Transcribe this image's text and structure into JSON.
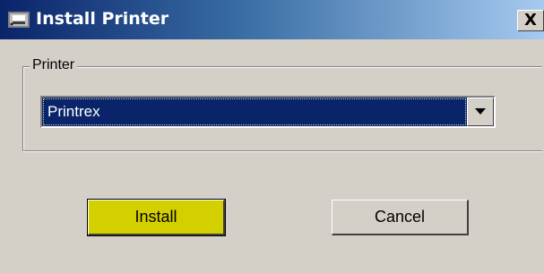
{
  "window": {
    "title": "Install Printer",
    "close_label": "X"
  },
  "printer_group": {
    "legend": "Printer",
    "selected_printer": "Printrex"
  },
  "buttons": {
    "install_label": "Install",
    "cancel_label": "Cancel"
  },
  "colors": {
    "titlebar_start": "#0a246a",
    "titlebar_end": "#a6caf0",
    "selection": "#0a246a",
    "install_button": "#d4d000",
    "face": "#d4d0c8"
  },
  "icons": {
    "app": "printer-app-icon",
    "dropdown": "chevron-down-icon"
  }
}
